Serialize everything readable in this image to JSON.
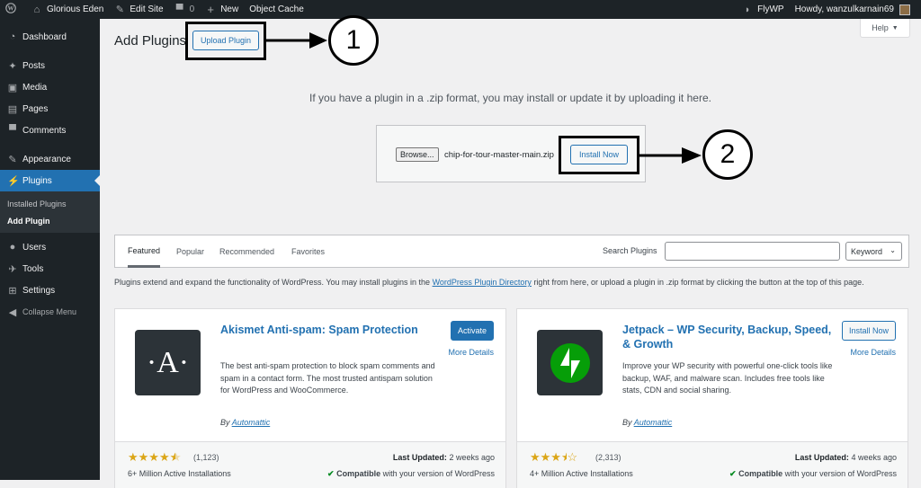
{
  "adminbar": {
    "site_name": "Glorious Eden",
    "edit_site": "Edit Site",
    "comments_count": "0",
    "new_label": "New",
    "object_cache": "Object Cache",
    "flywp": "FlyWP",
    "howdy": "Howdy, wanzulkarnain69"
  },
  "sidebar": {
    "dashboard": "Dashboard",
    "posts": "Posts",
    "media": "Media",
    "pages": "Pages",
    "comments": "Comments",
    "appearance": "Appearance",
    "plugins": "Plugins",
    "installed_plugins": "Installed Plugins",
    "add_plugin": "Add Plugin",
    "users": "Users",
    "tools": "Tools",
    "settings": "Settings",
    "collapse": "Collapse Menu"
  },
  "header": {
    "title": "Add Plugins",
    "upload_button": "Upload Plugin",
    "help": "Help"
  },
  "upload": {
    "help_text": "If you have a plugin in a .zip format, you may install or update it by uploading it here.",
    "browse": "Browse...",
    "file_name": "chip-for-tour-master-main.zip",
    "install_now": "Install Now"
  },
  "annotations": {
    "one": "1",
    "two": "2"
  },
  "filter": {
    "tabs": [
      "Featured",
      "Popular",
      "Recommended",
      "Favorites"
    ],
    "search_label": "Search Plugins",
    "search_value": "",
    "keyword": "Keyword"
  },
  "intro": {
    "before": "Plugins extend and expand the functionality of WordPress. You may install plugins in the ",
    "link": "WordPress Plugin Directory",
    "after": " right from here, or upload a plugin in .zip format by clicking the button at the top of this page."
  },
  "cards": [
    {
      "name": "Akismet Anti-spam: Spam Protection",
      "action": "Activate",
      "more": "More Details",
      "description": "The best anti-spam protection to block spam comments and spam in a contact form. The most trusted antispam solution for WordPress and WooCommerce.",
      "by": "By",
      "author": "Automattic",
      "rating": 4.5,
      "rating_count": "(1,123)",
      "updated_label": "Last Updated:",
      "updated": "2 weeks ago",
      "installs": "6+ Million Active Installations",
      "compat_bold": "Compatible",
      "compat_rest": "with your version of WordPress",
      "icon": "akismet-A-icon",
      "icon_letter": "·A·"
    },
    {
      "name": "Jetpack – WP Security, Backup, Speed, & Growth",
      "action": "Install Now",
      "more": "More Details",
      "description": "Improve your WP security with powerful one-click tools like backup, WAF, and malware scan. Includes free tools like stats, CDN and social sharing.",
      "by": "By",
      "author": "Automattic",
      "rating": 3.5,
      "rating_count": "(2,313)",
      "updated_label": "Last Updated:",
      "updated": "4 weeks ago",
      "installs": "4+ Million Active Installations",
      "compat_bold": "Compatible",
      "compat_rest": "with your version of WordPress",
      "icon": "jetpack-bolt-icon"
    }
  ],
  "colors": {
    "admin_dark": "#1d2327",
    "accent": "#2271b1",
    "star": "#dba617",
    "jetpack_green": "#069e08"
  }
}
